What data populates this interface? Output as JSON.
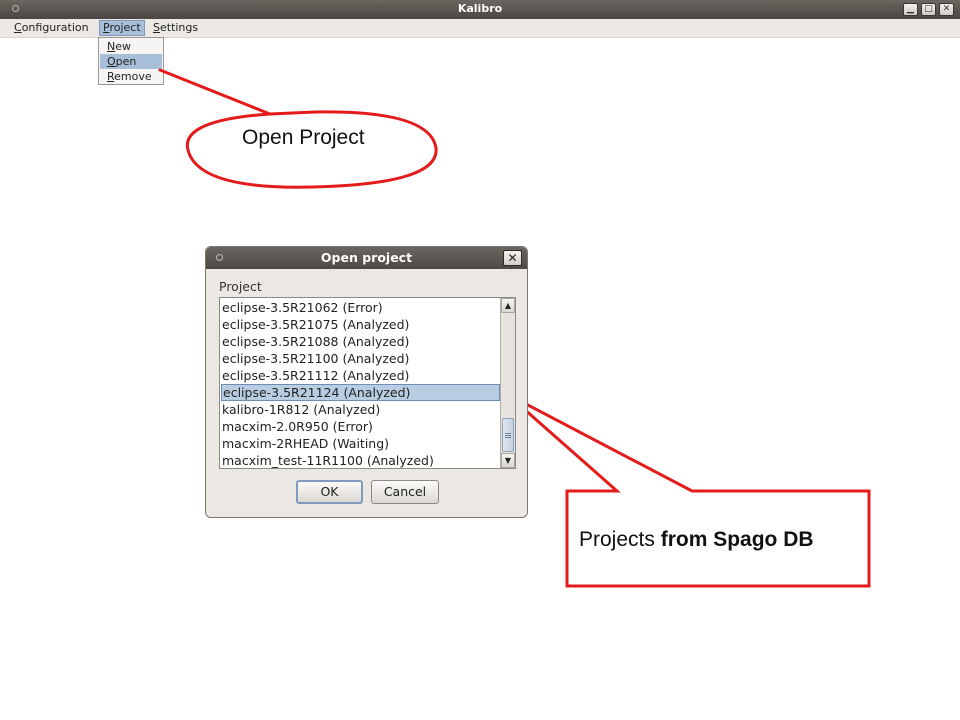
{
  "window": {
    "title": "Kalibro"
  },
  "window_buttons": [
    "minimize",
    "maximize",
    "close"
  ],
  "menubar": {
    "items": [
      {
        "label": "Configuration"
      },
      {
        "label": "Project"
      },
      {
        "label": "Settings"
      }
    ],
    "active": "Project"
  },
  "project_menu": {
    "items": [
      {
        "label": "New"
      },
      {
        "label": "Open"
      },
      {
        "label": "Remove"
      }
    ],
    "selected": "Open"
  },
  "dialog": {
    "title": "Open project",
    "list_label": "Project",
    "items": [
      "eclipse-3.5R21062 (Error)",
      "eclipse-3.5R21075 (Analyzed)",
      "eclipse-3.5R21088 (Analyzed)",
      "eclipse-3.5R21100 (Analyzed)",
      "eclipse-3.5R21112 (Analyzed)",
      "eclipse-3.5R21124 (Analyzed)",
      "kalibro-1R812 (Analyzed)",
      "macxim-2.0R950 (Error)",
      "macxim-2RHEAD (Waiting)",
      "macxim_test-11R1100 (Analyzed)"
    ],
    "selected_item": "eclipse-3.5R21124 (Analyzed)",
    "ok_label": "OK",
    "cancel_label": "Cancel"
  },
  "callouts": {
    "open_project": "Open Project",
    "projects_prefix": "Projects ",
    "projects_bold": "from Spago DB"
  },
  "colors": {
    "callout": "#e31b1b",
    "selection": "#a7bfd8",
    "titlebar": "#4a4540"
  }
}
